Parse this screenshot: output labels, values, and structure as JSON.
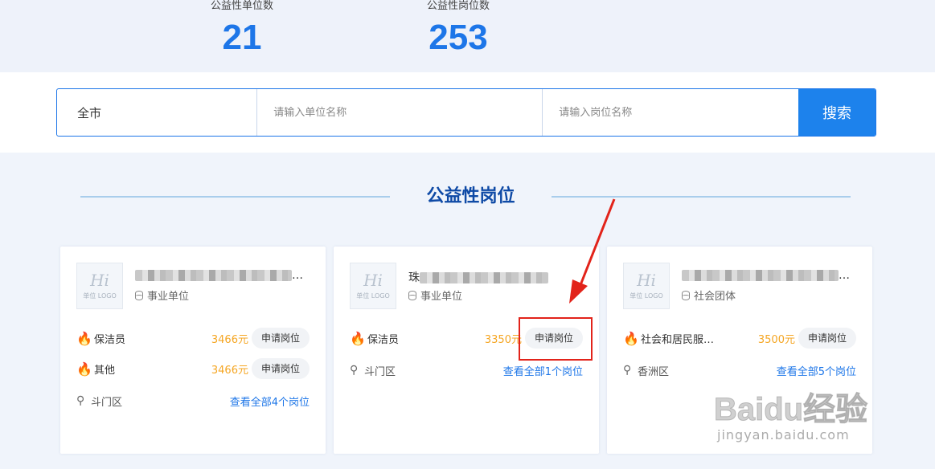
{
  "stats": [
    {
      "label": "公益性单位数",
      "value": "21"
    },
    {
      "label": "公益性岗位数",
      "value": "253"
    }
  ],
  "search": {
    "city": "全市",
    "unit_placeholder": "请输入单位名称",
    "post_placeholder": "请输入岗位名称",
    "button": "搜索"
  },
  "section_title": "公益性岗位",
  "cards": [
    {
      "org_name": "",
      "org_suffix": "…",
      "logo_text": "单位 LOGO",
      "org_type": "事业单位",
      "jobs": [
        {
          "name": "保洁员",
          "salary": "3466元",
          "apply": "申请岗位"
        },
        {
          "name": "其他",
          "salary": "3466元",
          "apply": "申请岗位"
        }
      ],
      "district": "斗门区",
      "view_all": "查看全部4个岗位"
    },
    {
      "org_name": "珠",
      "org_suffix": "",
      "logo_text": "单位 LOGO",
      "org_type": "事业单位",
      "jobs": [
        {
          "name": "保洁员",
          "salary": "3350元",
          "apply": "申请岗位"
        }
      ],
      "district": "斗门区",
      "view_all": "查看全部1个岗位"
    },
    {
      "org_name": "",
      "org_suffix": "…",
      "logo_text": "单位 LOGO",
      "org_type": "社会团体",
      "jobs": [
        {
          "name": "社会和居民服…",
          "salary": "3500元",
          "apply": "申请岗位"
        }
      ],
      "district": "香洲区",
      "view_all": "查看全部5个岗位"
    }
  ],
  "watermark": {
    "brand": "Baidu经验",
    "url": "jingyan.baidu.com"
  },
  "icons": {
    "fire": "fire-icon",
    "location": "location-pin-icon",
    "type": "database-icon",
    "arrow": "red-arrow-annotation"
  },
  "colors": {
    "accent": "#1d76e8",
    "salary": "#f5a623",
    "annotation": "#e2231a"
  }
}
